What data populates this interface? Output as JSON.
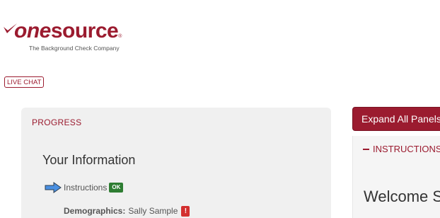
{
  "brand": {
    "name_part1": "one",
    "name_part2": "source",
    "registered_mark": "®",
    "tagline": "The Background Check Company",
    "accent_color": "#9b1b2f"
  },
  "live_chat": {
    "label": "LIVE CHAT"
  },
  "progress": {
    "title": "PROGRESS",
    "section_heading": "Your Information",
    "steps": [
      {
        "label": "Instructions",
        "status": "OK",
        "status_color": "#2e7d32",
        "current": true
      }
    ],
    "demographics": {
      "label": "Demographics:",
      "value": "Sally Sample",
      "status": "!",
      "status_color": "#d32f2f"
    }
  },
  "right_panel": {
    "expand_button_label": "Expand All Panels",
    "instructions_header": "INSTRUCTIONS",
    "welcome_heading": "Welcome S"
  }
}
